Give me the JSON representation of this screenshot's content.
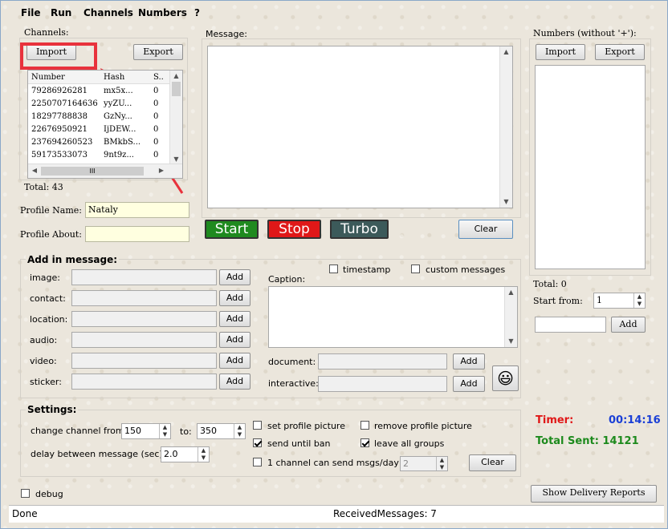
{
  "menu": [
    "File",
    "Run",
    "Channels",
    "Numbers",
    "?"
  ],
  "channels": {
    "label": "Channels:",
    "import": "Import",
    "export": "Export",
    "columns": [
      "Number",
      "Hash",
      "S.."
    ],
    "rows": [
      [
        "79286926281",
        "mx5x...",
        "0"
      ],
      [
        "2250707164636",
        "yyZU...",
        "0"
      ],
      [
        "18297788838",
        "GzNy...",
        "0"
      ],
      [
        "22676950921",
        "IjDEW...",
        "0"
      ],
      [
        "237694260523",
        "BMkbS...",
        "0"
      ],
      [
        "59173533073",
        "9nt9z...",
        "0"
      ]
    ],
    "total": "Total: 43",
    "profile_name_label": "Profile Name:",
    "profile_name_value": "Nataly",
    "profile_about_label": "Profile About:",
    "profile_about_value": ""
  },
  "message": {
    "label": "Message:",
    "start": "Start",
    "stop": "Stop",
    "turbo": "Turbo",
    "clear": "Clear",
    "start_color": "#1f8a1f",
    "stop_color": "#e01818",
    "turbo_color": "#3c5a5a"
  },
  "numbers": {
    "label": "Numbers (without '+'):",
    "import": "Import",
    "export": "Export",
    "total": "Total: 0",
    "start_from_label": "Start from:",
    "start_from_value": "1",
    "add": "Add"
  },
  "add_in_message": {
    "title": "Add in message:",
    "rows": [
      {
        "label": "image:",
        "button": "Add"
      },
      {
        "label": "contact:",
        "button": "Add"
      },
      {
        "label": "location:",
        "button": "Add"
      },
      {
        "label": "audio:",
        "button": "Add"
      },
      {
        "label": "video:",
        "button": "Add"
      },
      {
        "label": "sticker:",
        "button": "Add"
      }
    ],
    "timestamp": "timestamp",
    "custom_messages": "custom messages",
    "caption": "Caption:",
    "document": "document:",
    "interactive": "interactive:",
    "add": "Add",
    "emoji": "😃"
  },
  "settings": {
    "title": "Settings:",
    "change_channel_from": "change channel from:",
    "from_value": "150",
    "to_label": "to:",
    "to_value": "350",
    "delay_label": "delay between message (sec)",
    "delay_value": "2.0",
    "set_profile_picture": "set profile picture",
    "send_until_ban": "send until ban",
    "one_channel": "1 channel can send msgs/day",
    "one_channel_value": "2",
    "remove_profile_picture": "remove profile picture",
    "leave_all_groups": "leave all groups",
    "clear": "Clear"
  },
  "timer": {
    "label": "Timer:",
    "value": "00:14:16",
    "total_sent": "Total Sent: 14121",
    "label_color": "#e01818",
    "value_color": "#1a3fd6",
    "total_color": "#1d8a1d"
  },
  "debug": "debug",
  "show_delivery": "Show Delivery Reports",
  "status": {
    "left": "Done",
    "center": "ReceivedMessages: 7"
  }
}
